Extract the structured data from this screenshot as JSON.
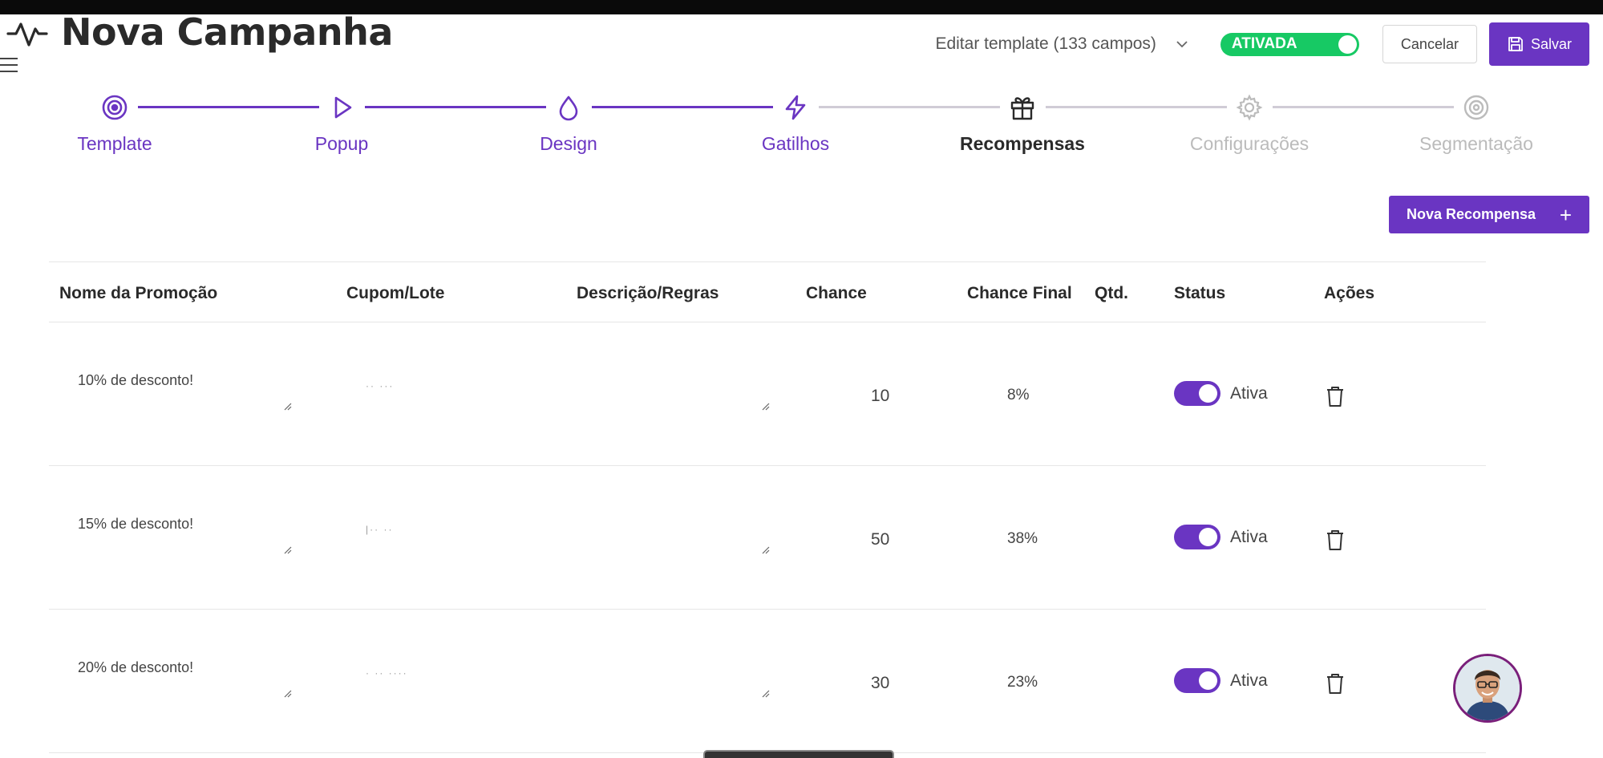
{
  "header": {
    "title": "Nova Campanha",
    "template_select": "Editar template (133 campos)",
    "activation_label": "ATIVADA",
    "cancel_label": "Cancelar",
    "save_label": "Salvar",
    "accent_color": "#6a35c2",
    "toggle_color": "#17c964"
  },
  "stepper": {
    "current_index": 4,
    "steps": [
      {
        "label": "Template",
        "icon": "target-icon",
        "state": "done"
      },
      {
        "label": "Popup",
        "icon": "play-icon",
        "state": "done"
      },
      {
        "label": "Design",
        "icon": "droplet-icon",
        "state": "done"
      },
      {
        "label": "Gatilhos",
        "icon": "lightning-icon",
        "state": "done"
      },
      {
        "label": "Recompensas",
        "icon": "gift-icon",
        "state": "current"
      },
      {
        "label": "Configurações",
        "icon": "gear-icon",
        "state": "todo"
      },
      {
        "label": "Segmentação",
        "icon": "target-icon",
        "state": "todo"
      }
    ]
  },
  "new_reward_label": "Nova Recompensa",
  "table": {
    "headers": [
      "Nome da Promoção",
      "Cupom/Lote",
      "Descrição/Regras",
      "Chance",
      "Chance Final",
      "Qtd.",
      "Status",
      "Ações"
    ],
    "rows": [
      {
        "promo": "10% de desconto!",
        "chance": "10",
        "final": "8%",
        "status": "Ativa"
      },
      {
        "promo": "15% de desconto!",
        "chance": "50",
        "final": "38%",
        "status": "Ativa"
      },
      {
        "promo": "20% de desconto!",
        "chance": "30",
        "final": "23%",
        "status": "Ativa"
      }
    ]
  }
}
